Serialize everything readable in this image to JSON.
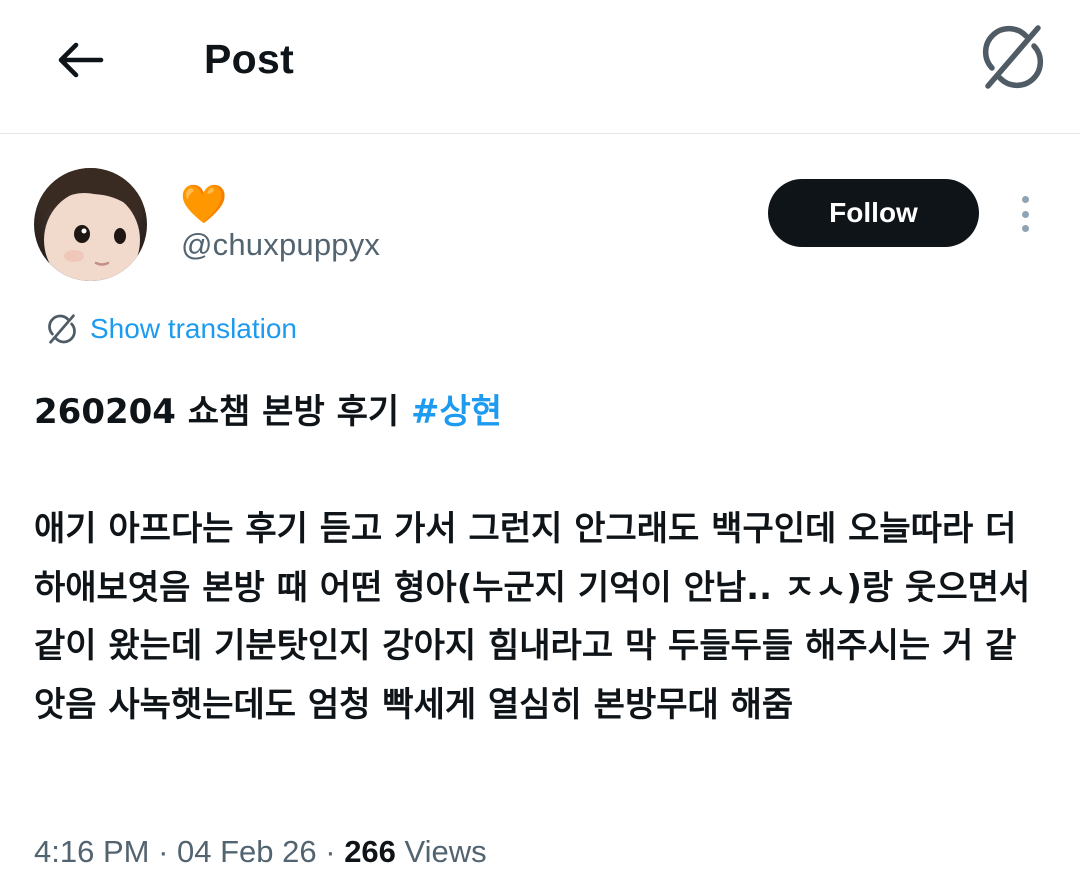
{
  "header": {
    "title": "Post",
    "back_icon": "arrow-left-icon",
    "grok_icon": "grok-icon"
  },
  "author": {
    "display_name": "🧡",
    "handle": "@chuxpuppyx",
    "avatar": "child-photo-avatar"
  },
  "follow_label": "Follow",
  "more_icon": "more-vertical-icon",
  "translation": {
    "label": "Show translation",
    "icon": "grok-icon"
  },
  "post": {
    "line1_text": "260204 쇼챔 본방 후기 ",
    "hashtag": "#상현",
    "body": "애기 아프다는 후기 듣고 가서 그런지 안그래도 백구인데 오늘따라 더 하애보엿음 본방 때 어떤 형아(누군지 기억이 안남.. ㅈㅅ)랑 웃으면서 같이 왔는데 기분탓인지 강아지 힘내라고 막 두들두들 해주시는 거 같앗음 사녹햇는데도 엄청 빡세게 열심히 본방무대 해줌"
  },
  "meta": {
    "time": "4:16 PM",
    "separator": " · ",
    "date": "04 Feb 26",
    "views_count": "266",
    "views_label": " Views"
  },
  "colors": {
    "accent": "#1d9bf0",
    "text": "#0f1419",
    "secondary_text": "#536471",
    "divider": "#e1e6ea",
    "follow_bg": "#0f1419"
  }
}
